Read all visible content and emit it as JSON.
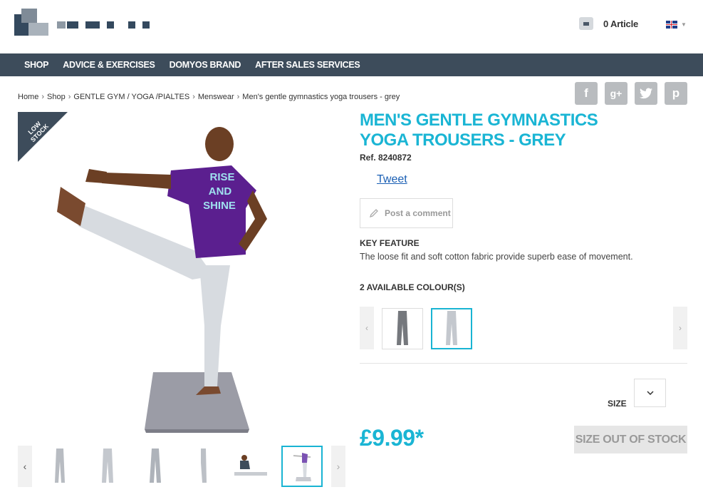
{
  "header": {
    "cart_count": "0 Article"
  },
  "nav": {
    "items": [
      "SHOP",
      "ADVICE & EXERCISES",
      "DOMYOS BRAND",
      "AFTER SALES SERVICES"
    ]
  },
  "breadcrumb": {
    "items": [
      "Home",
      "Shop",
      "GENTLE GYM / YOGA /PIALTES",
      "Menswear",
      "Men's gentle gymnastics yoga trousers - grey"
    ],
    "separator": "›"
  },
  "social": {
    "facebook": "f",
    "googleplus": "g+",
    "twitter": "t",
    "pinterest": "p"
  },
  "product": {
    "ribbon": "LOW STOCK",
    "shirt_text": [
      "RISE",
      "AND",
      "SHINE"
    ],
    "title": "MEN'S GENTLE GYMNASTICS YOGA TROUSERS - GREY",
    "ref": "Ref. 8240872",
    "tweet": "Tweet",
    "comment_button": "Post a comment",
    "key_feature_title": "KEY FEATURE",
    "key_feature_text": "The loose fit and soft cotton fabric provide superb ease of movement.",
    "colours_title": "2 AVAILABLE COLOUR(S)",
    "size_label": "SIZE",
    "price": "£9.99*",
    "stock_button": "SIZE OUT OF STOCK"
  },
  "colors": {
    "accent": "#1ab5d4",
    "nav_bg": "#3d4c5b",
    "link": "#1a5fb4"
  }
}
